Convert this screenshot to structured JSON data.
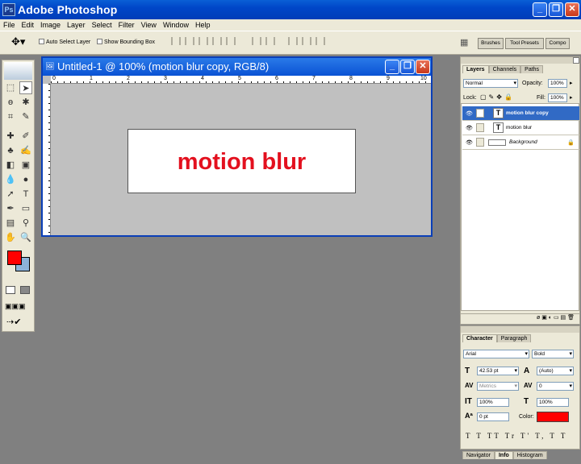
{
  "app": {
    "title": "Adobe Photoshop",
    "icon_name": "photoshop-icon",
    "window_buttons": [
      "_",
      "❐",
      "✕"
    ]
  },
  "menu": [
    "File",
    "Edit",
    "Image",
    "Layer",
    "Select",
    "Filter",
    "View",
    "Window",
    "Help"
  ],
  "options": {
    "auto_select_label": "Auto Select Layer",
    "bounding_box_label": "Show Bounding Box",
    "wells": [
      "Brushes",
      "Tool Presets",
      "Compo"
    ]
  },
  "toolbox": {
    "foreground_color": "#ff0000",
    "background_color": "#8db3d9"
  },
  "document": {
    "title": "Untitled-1 @ 100% (motion blur copy, RGB/8)",
    "ruler_numbers": [
      "0",
      "1",
      "2",
      "3",
      "4",
      "5",
      "6",
      "7",
      "8",
      "9",
      "10"
    ],
    "canvas_text": "motion blur",
    "canvas_text_color": "#e3101e"
  },
  "layers_panel": {
    "tabs": [
      "Layers",
      "Channels",
      "Paths"
    ],
    "active_tab": "Layers",
    "blend_mode": "Normal",
    "opacity_label": "Opacity:",
    "opacity": "100%",
    "lock_label": "Lock:",
    "fill_label": "Fill:",
    "fill": "100%",
    "layers": [
      {
        "name": "motion blur copy",
        "type": "text",
        "selected": true
      },
      {
        "name": "motion blur",
        "type": "text",
        "selected": false
      },
      {
        "name": "Background",
        "type": "image",
        "selected": false
      }
    ],
    "footer_icons": "ø ▣ ◐ ▭ ▤ 🗑"
  },
  "character_panel": {
    "tabs": [
      "Character",
      "Paragraph"
    ],
    "active_tab": "Character",
    "font_family": "Arial",
    "font_style": "Bold",
    "font_size": "42.53 pt",
    "leading": "(Auto)",
    "kerning": "Metrics",
    "tracking": "0",
    "vertical_scale": "100%",
    "horizontal_scale": "100%",
    "baseline_shift": "0 pt",
    "color_label": "Color:",
    "color": "#ff0000",
    "style_buttons": "T T TT Tr T' T, T T"
  },
  "bottom_panel": {
    "tabs": [
      "Navigator",
      "Info",
      "Histogram"
    ],
    "active_tab": "Info"
  }
}
